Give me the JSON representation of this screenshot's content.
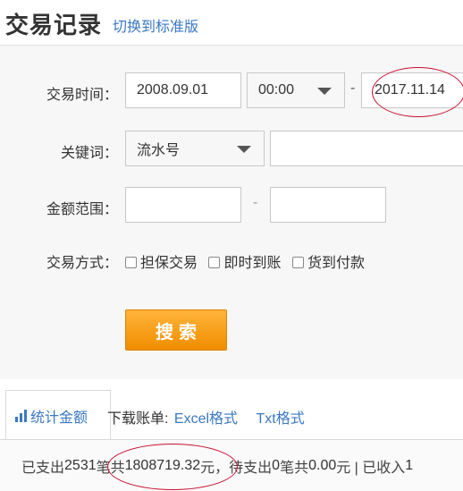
{
  "header": {
    "title": "交易记录",
    "switch_link": "切换到标准版"
  },
  "form": {
    "time_label": "交易时间：",
    "start_date": "2008.09.01",
    "start_time": "00:00",
    "range_separator": "-",
    "end_date": "2017.11.14",
    "keyword_label": "关键词：",
    "keyword_type": "流水号",
    "keyword_value": "",
    "amount_label": "金额范围：",
    "amount_min": "",
    "amount_max": "",
    "method_label": "交易方式：",
    "methods": [
      {
        "label": "担保交易",
        "checked": false
      },
      {
        "label": "即时到账",
        "checked": false
      },
      {
        "label": "货到付款",
        "checked": false
      }
    ],
    "search_button": "搜索"
  },
  "stats": {
    "tab_label": "统计金额",
    "download_label": "下载账单:",
    "excel_link": "Excel格式",
    "txt_link": "Txt格式",
    "summary": {
      "paid_prefix": "已支出",
      "paid_count": "2531",
      "paid_mid": "笔共",
      "paid_amount": "1808719.32",
      "paid_suffix": "元，待支出",
      "pending_count": "0",
      "pending_mid": "笔共",
      "pending_amount": "0.00",
      "pending_suffix": "元 | 已收入",
      "income_count": "1"
    }
  },
  "colors": {
    "link": "#3a78c3",
    "button": "#f39a14",
    "annotation": "#c8102e"
  },
  "icons": [
    "dropdown-caret-icon",
    "bar-chart-icon",
    "checkbox-icon"
  ]
}
